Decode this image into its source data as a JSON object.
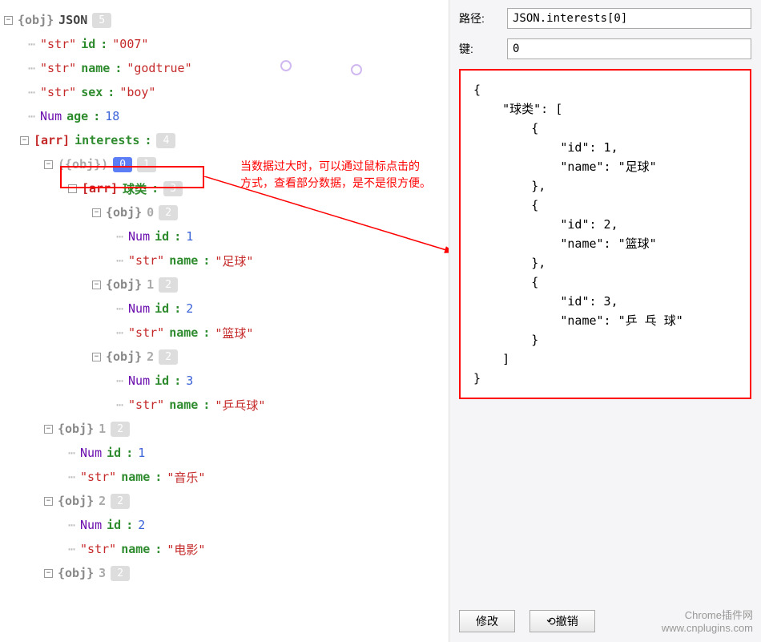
{
  "tree": {
    "root_type": "{obj}",
    "root_label": "JSON",
    "root_count": "5",
    "id_key": "id",
    "id_val": "\"007\"",
    "name_key": "name",
    "name_val": "\"godtrue\"",
    "sex_key": "sex",
    "sex_val": "\"boy\"",
    "age_key": "age",
    "age_val": "18",
    "interests_key": "interests",
    "interests_count": "4",
    "i0_idx": "0",
    "i0_count": "1",
    "ball_key": "球类",
    "ball_count": "3",
    "b0_idx": "0",
    "b0_count": "2",
    "b0_id": "1",
    "b0_name": "\"足球\"",
    "b1_idx": "1",
    "b1_count": "2",
    "b1_id": "2",
    "b1_name": "\"篮球\"",
    "b2_idx": "2",
    "b2_count": "2",
    "b2_id": "3",
    "b2_name": "\"乒乓球\"",
    "i1_idx": "1",
    "i1_count": "2",
    "i1_id": "1",
    "i1_name": "\"音乐\"",
    "i2_idx": "2",
    "i2_count": "2",
    "i2_id": "2",
    "i2_name": "\"电影\"",
    "i3_idx": "3",
    "i3_count": "2",
    "str_label": "\"str\"",
    "num_label": "Num",
    "arr_label": "[arr]",
    "obj_label": "{obj}",
    "id_label": "id",
    "name_label": "name"
  },
  "annotation": "当数据过大时，可以通过鼠标点击的\n方式，查看部分数据，是不是很方便。",
  "right": {
    "path_label": "路径:",
    "path_value": "JSON.interests[0]",
    "key_label": "键:",
    "key_value": "0",
    "json_text": "{\n    \"球类\": [\n        {\n            \"id\": 1,\n            \"name\": \"足球\"\n        },\n        {\n            \"id\": 2,\n            \"name\": \"篮球\"\n        },\n        {\n            \"id\": 3,\n            \"name\": \"乒 乓 球\"\n        }\n    ]\n}",
    "modify_btn": "修改",
    "undo_btn": "⟲撤销"
  },
  "watermark": {
    "line1": "Chrome插件网",
    "line2": "www.cnplugins.com"
  }
}
